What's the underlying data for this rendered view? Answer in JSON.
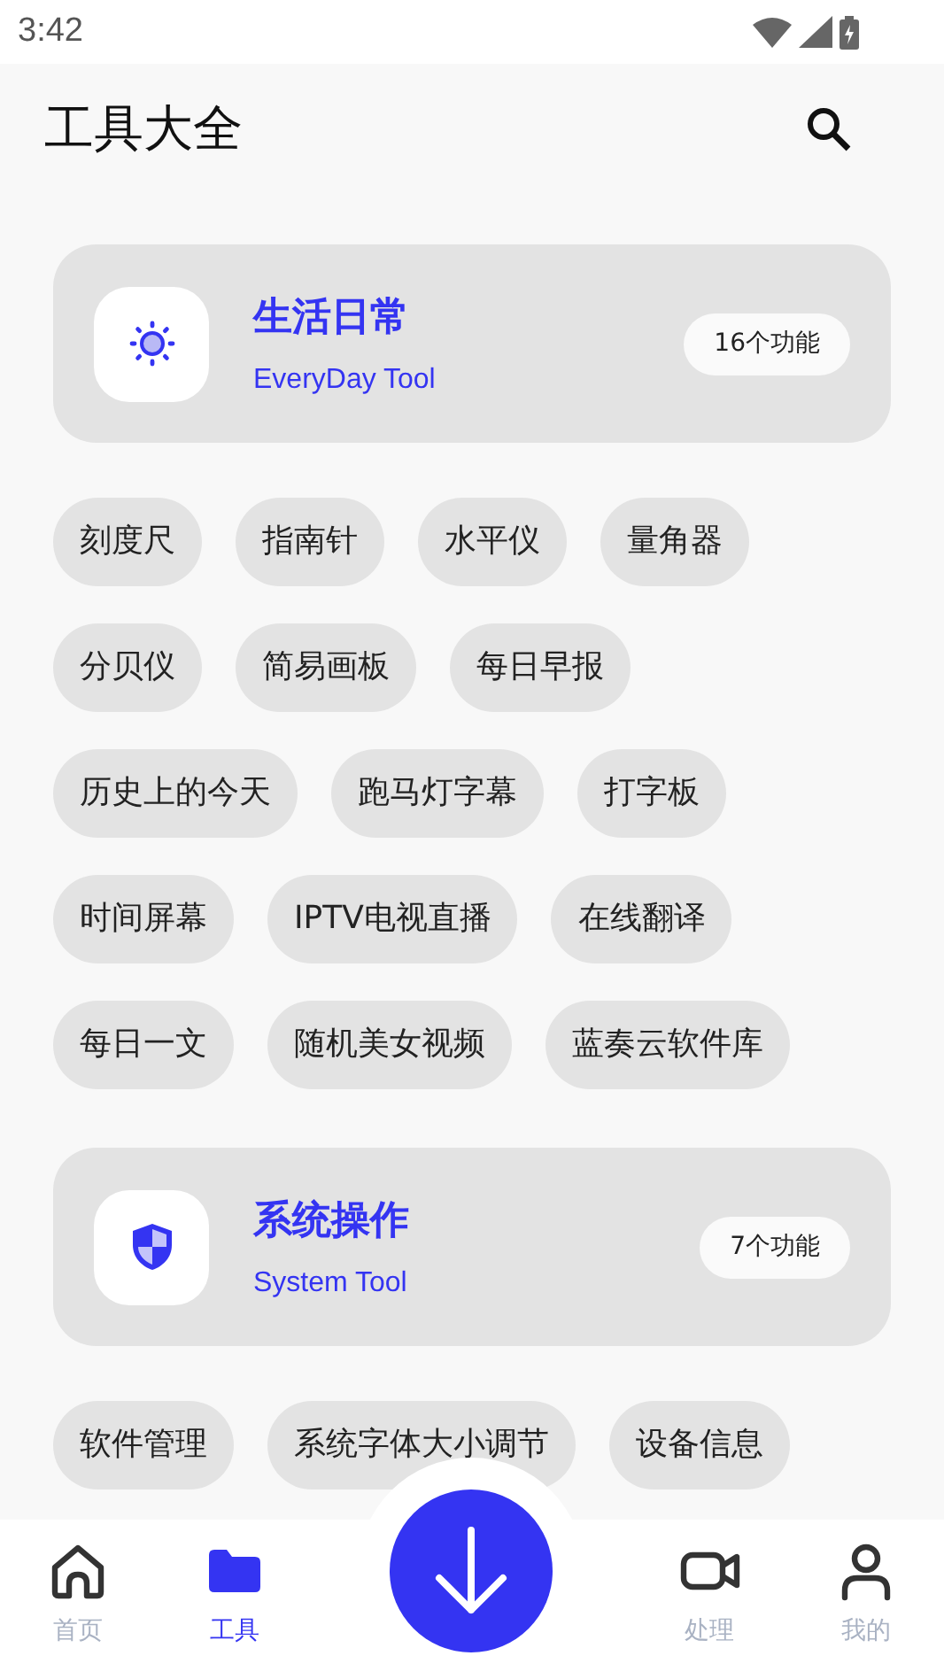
{
  "status_bar": {
    "time": "3:42"
  },
  "app_bar": {
    "title": "工具大全"
  },
  "sections": [
    {
      "title": "生活日常",
      "subtitle": "EveryDay Tool",
      "count": "16个功能",
      "tools": [
        "刻度尺",
        "指南针",
        "水平仪",
        "量角器",
        "分贝仪",
        "简易画板",
        "每日早报",
        "历史上的今天",
        "跑马灯字幕",
        "打字板",
        "时间屏幕",
        "IPTV电视直播",
        "在线翻译",
        "每日一文",
        "随机美女视频",
        "蓝奏云软件库"
      ]
    },
    {
      "title": "系统操作",
      "subtitle": "System Tool",
      "count": "7个功能",
      "tools": [
        "软件管理",
        "系统字体大小调节",
        "设备信息"
      ]
    }
  ],
  "nav": [
    {
      "label": "首页",
      "selected": false
    },
    {
      "label": "工具",
      "selected": true
    },
    {
      "label": "处理",
      "selected": false
    },
    {
      "label": "我的",
      "selected": false
    }
  ]
}
